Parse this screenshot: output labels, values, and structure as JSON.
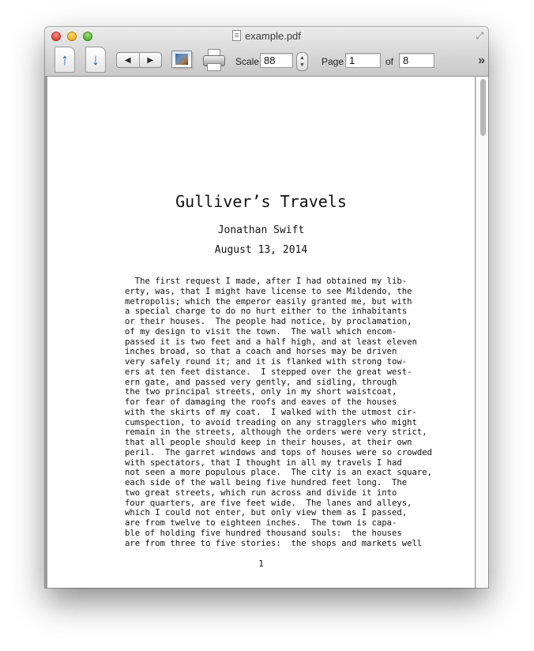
{
  "window": {
    "title": "example.pdf"
  },
  "toolbar": {
    "prev_page_icon": "page-up-arrow-icon",
    "next_page_icon": "page-down-arrow-icon",
    "back_glyph": "◀",
    "forward_glyph": "▶",
    "scale_label": "Scale",
    "scale_value": "88",
    "page_label": "Page",
    "page_value": "1",
    "of_label": "of",
    "total_pages": "8",
    "overflow_glyph": "»"
  },
  "document": {
    "title": "Gulliver’s Travels",
    "author": "Jonathan Swift",
    "date": "August 13, 2014",
    "lines": [
      "  The first request I made, after I had obtained my lib-",
      "erty, was, that I might have license to see Mildendo, the",
      "metropolis; which the emperor easily granted me, but with",
      "a special charge to do no hurt either to the inhabitants",
      "or their houses.  The people had notice, by proclamation,",
      "of my design to visit the town.  The wall which encom-",
      "passed it is two feet and a half high, and at least eleven",
      "inches broad, so that a coach and horses may be driven",
      "very safely round it; and it is flanked with strong tow-",
      "ers at ten feet distance.  I stepped over the great west-",
      "ern gate, and passed very gently, and sidling, through",
      "the two principal streets, only in my short waistcoat,",
      "for fear of damaging the roofs and eaves of the houses",
      "with the skirts of my coat.  I walked with the utmost cir-",
      "cumspection, to avoid treading on any stragglers who might",
      "remain in the streets, although the orders were very strict,",
      "that all people should keep in their houses, at their own",
      "peril.  The garret windows and tops of houses were so crowded",
      "with spectators, that I thought in all my travels I had",
      "not seen a more populous place.  The city is an exact square,",
      "each side of the wall being five hundred feet long.  The",
      "two great streets, which run across and divide it into",
      "four quarters, are five feet wide.  The lanes and alleys,",
      "which I could not enter, but only view them as I passed,",
      "are from twelve to eighteen inches.  The town is capa-",
      "ble of holding five hundred thousand souls:  the houses",
      "are from three to five stories:  the shops and markets well"
    ],
    "page_number": "1"
  }
}
